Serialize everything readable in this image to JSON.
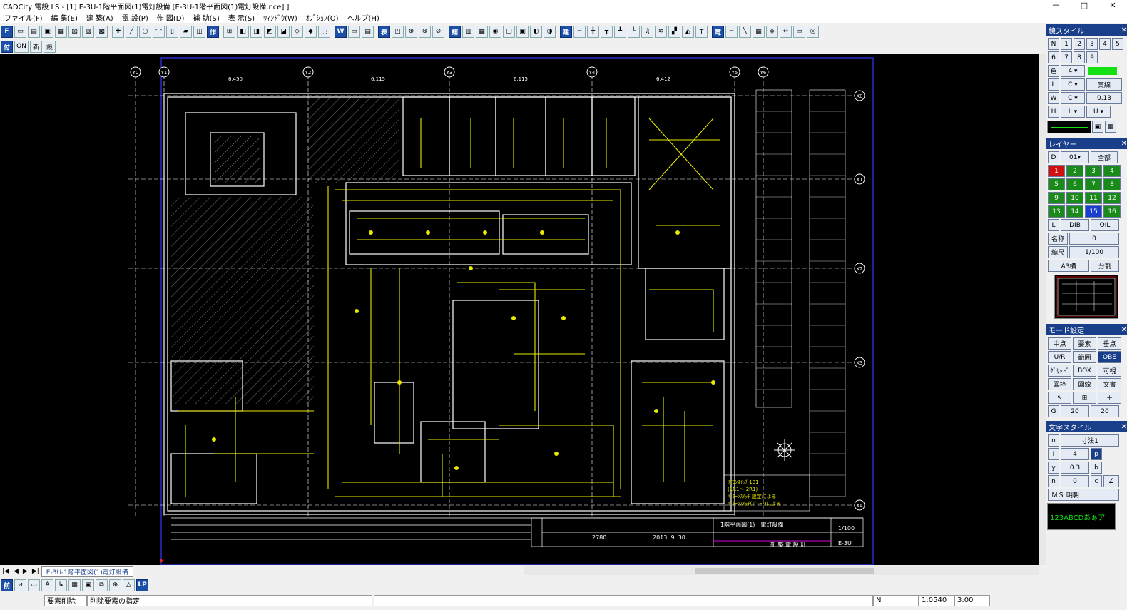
{
  "window": {
    "title": "CADCity 電設 LS - [1] E-3U-1階平面図(1)電灯設備 [E-3U-1階平面図(1)電灯設備.nce] ]",
    "controls": [
      "－",
      "□",
      "✕"
    ]
  },
  "menu": [
    "ファイル(F)",
    "編 集(E)",
    "建 築(A)",
    "電 設(P)",
    "作 図(D)",
    "補 助(S)",
    "表 示(S)",
    "ｳｨﾝﾄﾞｳ(W)",
    "ｵﾌﾟｼｮﾝ(O)",
    "ヘルプ(H)"
  ],
  "toolbar_row2": [
    "付",
    "ON",
    "新",
    "設"
  ],
  "drawing": {
    "grid_labels_top": [
      "Y0",
      "Y1",
      "Y2",
      "Y3",
      "Y4",
      "Y5",
      "Y6"
    ],
    "grid_labels_right": [
      "X0",
      "X1",
      "X2",
      "X3",
      "X4"
    ],
    "dims": [
      "6,450",
      "6,115",
      "6,115",
      "6,412"
    ],
    "title_block": {
      "drawing_name": "1階平面図(1)　電灯設備",
      "scale": "1/100",
      "company": "新 築 電 設 計",
      "sheet": "E-3U",
      "number": "2780",
      "date": "2013. 9. 30"
    },
    "notes": [
      "ﾘﾓｺﾝｽｲｯﾁ 101",
      "(1R1～ 2R1)",
      "ﾊﾟﾀｰﾝｽｲｯﾁ 設定による",
      "ﾊﾟﾀｰﾝｽｲｯﾁ(ﾌﾟﾚｰﾄ)による"
    ]
  },
  "panels": {
    "line_style": {
      "title": "線スタイル",
      "line_type": "実線",
      "width": "0.13"
    },
    "layer": {
      "title": "レイヤー",
      "current": "01",
      "all": "全部",
      "grid": [
        "1",
        "2",
        "3",
        "4",
        "5",
        "6",
        "7",
        "8",
        "9",
        "10",
        "11",
        "12",
        "13",
        "14",
        "15",
        "16"
      ],
      "special_a": "DIB",
      "special_b": "OIL",
      "name_label": "名称",
      "name_value": "0",
      "scale_label": "縮尺",
      "scale_value": "1/100",
      "paper": "A3横",
      "split": "分割"
    },
    "mode": {
      "title": "モード設定",
      "buttons": [
        "中点",
        "要素",
        "垂点",
        "U/R",
        "範囲",
        "OBE",
        "ｸﾞﾘｯﾄﾞ",
        "BOX",
        "可視",
        "図枠",
        "図線",
        "文書"
      ],
      "angles": [
        "20",
        "20"
      ]
    },
    "text_style": {
      "title": "文字スタイル",
      "font_label": "寸法1",
      "height": "4",
      "ratio": "0.3",
      "angle": "0",
      "font": "ＭＳ 明朝",
      "preview": "123ABCDあぁア"
    }
  },
  "tab": "E-3U-1階平面図(1)電灯設備",
  "status": {
    "command": "要素削除",
    "prompt": "削除要素の指定",
    "coord_x": "1:0540",
    "coord_y": "3:00"
  }
}
